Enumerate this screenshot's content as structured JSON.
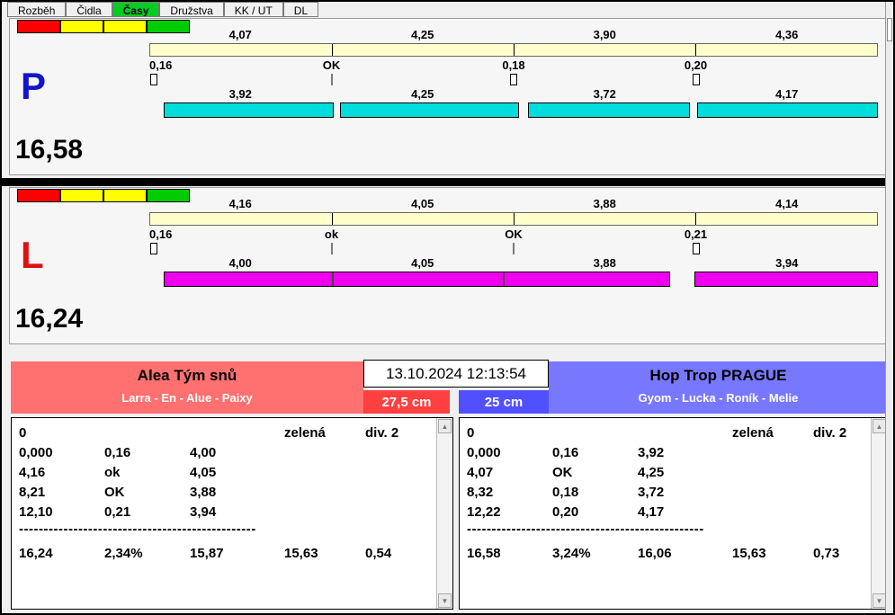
{
  "tabs": [
    {
      "label": "Rozběh"
    },
    {
      "label": "Čidla"
    },
    {
      "label": "Časy"
    },
    {
      "label": "Družstva"
    },
    {
      "label": "KK / UT"
    },
    {
      "label": "DL"
    }
  ],
  "panels": [
    {
      "letter": "P",
      "letter_color": "#1414cc",
      "total": "16,58",
      "status_squares": [
        "#ff0000",
        "#ffff00",
        "#ffff00",
        "#00cc00"
      ],
      "splits": [
        "4,07",
        "4,25",
        "3,90",
        "4,36"
      ],
      "reactions": [
        "0,16",
        "OK",
        "0,18",
        "0,20"
      ],
      "legs": [
        "3,92",
        "4,25",
        "3,72",
        "4,17"
      ],
      "bar_color": "#00dddd",
      "scale_color": "#ffffcc"
    },
    {
      "letter": "L",
      "letter_color": "#dd1111",
      "total": "16,24",
      "status_squares": [
        "#ff0000",
        "#ffff00",
        "#ffff00",
        "#00cc00"
      ],
      "splits": [
        "4,16",
        "4,05",
        "3,88",
        "4,14"
      ],
      "reactions": [
        "0,16",
        "ok",
        "OK",
        "0,21"
      ],
      "legs": [
        "4,00",
        "4,05",
        "3,88",
        "3,94"
      ],
      "bar_color": "#ee00ee",
      "scale_color": "#ffffcc"
    }
  ],
  "timestamp": "13.10.2024 12:13:54",
  "teams": [
    {
      "name": "Alea Tým snů",
      "members": "Larra - En - Alue - Paixy",
      "header_color": "#ff7070",
      "badge": "27,5 cm",
      "badge_color": "#ff4040",
      "table": {
        "col1": "0",
        "flag": "zelená",
        "division": "div. 2",
        "rows": [
          [
            "0,000",
            "0,16",
            "4,00"
          ],
          [
            "4,16",
            "ok",
            "4,05"
          ],
          [
            "8,21",
            "OK",
            "3,88"
          ],
          [
            "12,10",
            "0,21",
            "3,94"
          ]
        ],
        "separator": "------------------------------------------------",
        "totals": [
          "16,24",
          "2,34%",
          "15,87",
          "15,63",
          "0,54"
        ]
      }
    },
    {
      "name": "Hop Trop PRAGUE",
      "members": "Gyom - Lucka - Roník - Melie",
      "header_color": "#7878ff",
      "badge": "25 cm",
      "badge_color": "#5050ff",
      "table": {
        "col1": "0",
        "flag": "zelená",
        "division": "div. 2",
        "rows": [
          [
            "0,000",
            "0,16",
            "3,92"
          ],
          [
            "4,07",
            "OK",
            "4,25"
          ],
          [
            "8,32",
            "0,18",
            "3,72"
          ],
          [
            "12,22",
            "0,20",
            "4,17"
          ]
        ],
        "separator": "------------------------------------------------",
        "totals": [
          "16,58",
          "3,24%",
          "16,06",
          "15,63",
          "0,73"
        ]
      }
    }
  ],
  "scrollbar": {
    "up": "▲",
    "down": "▼"
  }
}
